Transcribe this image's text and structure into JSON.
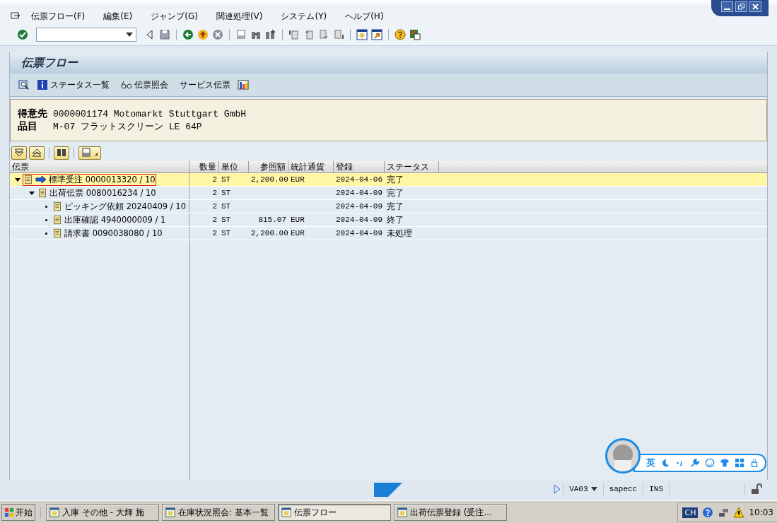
{
  "menu": [
    "伝票フロー(F)",
    "編集(E)",
    "ジャンプ(G)",
    "関連処理(V)",
    "システム(Y)",
    "ヘルプ(H)"
  ],
  "screen_title": "伝票フロー",
  "app_toolbar": [
    {
      "kind": "info",
      "label": "ステータス一覧"
    },
    {
      "kind": "glasses",
      "label": "伝票照会"
    },
    {
      "kind": "plain",
      "label": "サービス伝票"
    }
  ],
  "header": [
    {
      "label": "得意先",
      "value": "0000001174 Motomarkt Stuttgart GmbH"
    },
    {
      "label": "品目",
      "value": "M-07 フラットスクリーン LE 64P"
    }
  ],
  "table": {
    "columns": [
      "伝票",
      "数量",
      "単位",
      "参照額",
      "統計通貨",
      "登録",
      "ステータス"
    ],
    "rows": [
      {
        "document": "標準受注 0000013320 / 10",
        "quantity": "2",
        "unit": "ST",
        "amount": "2,200.00",
        "currency": "EUR",
        "date": "2024-04-06",
        "status": "完了",
        "selected": true,
        "current": true,
        "expanded": true,
        "children": [
          {
            "document": "出荷伝票 0080016234 / 10",
            "quantity": "2",
            "unit": "ST",
            "date": "2024-04-09",
            "status": "完了",
            "selected": false,
            "current": false,
            "expanded": true,
            "children": [
              {
                "document": "ピッキング依頼 20240409 / 10",
                "quantity": "2",
                "unit": "ST",
                "date": "2024-04-09",
                "status": "完了",
                "selected": false,
                "current": false
              },
              {
                "document": "出庫確認 4940000009 / 1",
                "quantity": "2",
                "unit": "ST",
                "amount": "815.07",
                "currency": "EUR",
                "date": "2024-04-09",
                "status": "終了",
                "selected": false,
                "current": false
              },
              {
                "document": "請求書 0090038080 / 10",
                "quantity": "2",
                "unit": "ST",
                "amount": "2,200.00",
                "currency": "EUR",
                "date": "2024-04-09",
                "status": "未処理",
                "selected": false,
                "current": false
              }
            ]
          }
        ]
      }
    ]
  },
  "ime": {
    "mode": "英"
  },
  "status_bar": {
    "transaction": "VA03",
    "system": "sapecc",
    "mode": "INS"
  },
  "taskbar": {
    "start": "开始",
    "tasks": [
      {
        "label": "入庫 その他 - 大輝 施",
        "selected": false
      },
      {
        "label": "在庫状況照会: 基本一覧",
        "selected": false
      },
      {
        "label": "伝票フロー",
        "selected": true
      },
      {
        "label": "出荷伝票登録 (受注...",
        "selected": false
      }
    ],
    "language": "CH",
    "clock": "10:03"
  }
}
